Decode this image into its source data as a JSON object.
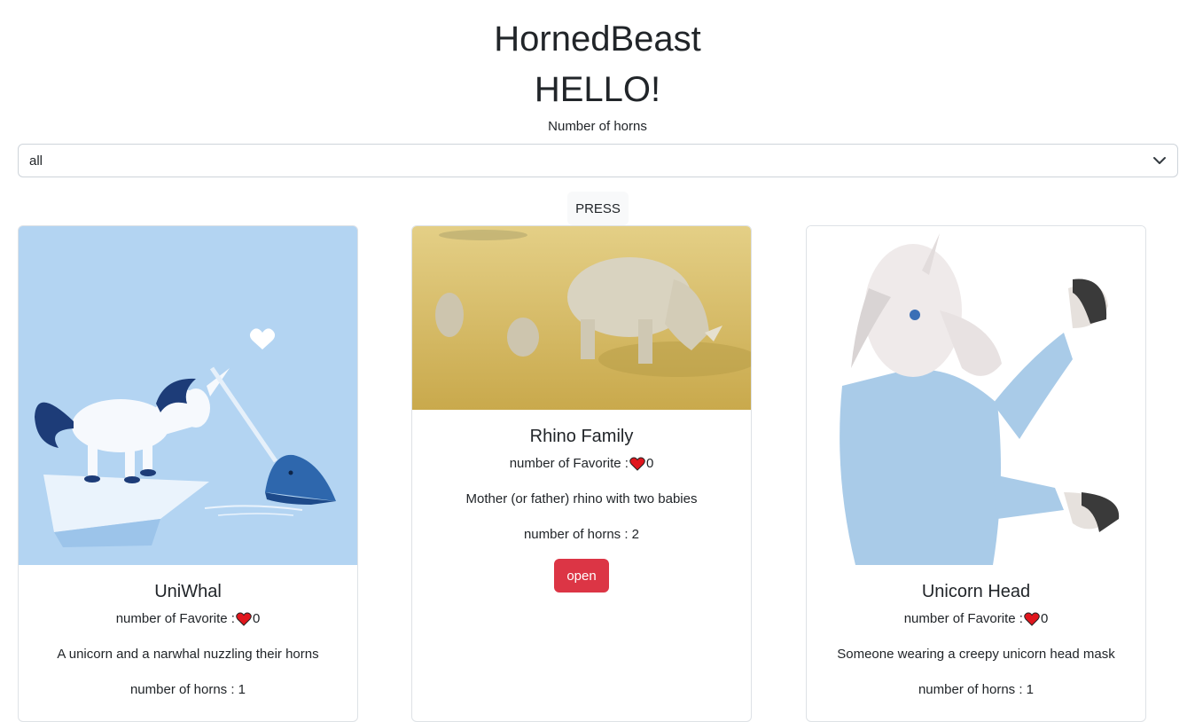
{
  "header": {
    "title": "HornedBeast",
    "greeting": "HELLO!"
  },
  "filter": {
    "label": "Number of horns",
    "selected": "all"
  },
  "press_label": "PRESS",
  "cards": [
    {
      "title": "UniWhal",
      "favorite_label": "number of Favorite :",
      "favorite_count": "0",
      "description": "A unicorn and a narwhal nuzzling their horns",
      "horns_label": "number of horns : 1"
    },
    {
      "title": "Rhino Family",
      "favorite_label": "number of Favorite :",
      "favorite_count": "0",
      "description": "Mother (or father) rhino with two babies",
      "horns_label": "number of horns : 2",
      "open_label": "open"
    },
    {
      "title": "Unicorn Head",
      "favorite_label": "number of Favorite :",
      "favorite_count": "0",
      "description": "Someone wearing a creepy unicorn head mask",
      "horns_label": "number of horns : 1"
    }
  ],
  "colors": {
    "open_button": "#dc3545",
    "heart": "#e0161d",
    "uniwhal_bg": "#b3d4f2",
    "rhino_field": "#d8bf6a"
  }
}
